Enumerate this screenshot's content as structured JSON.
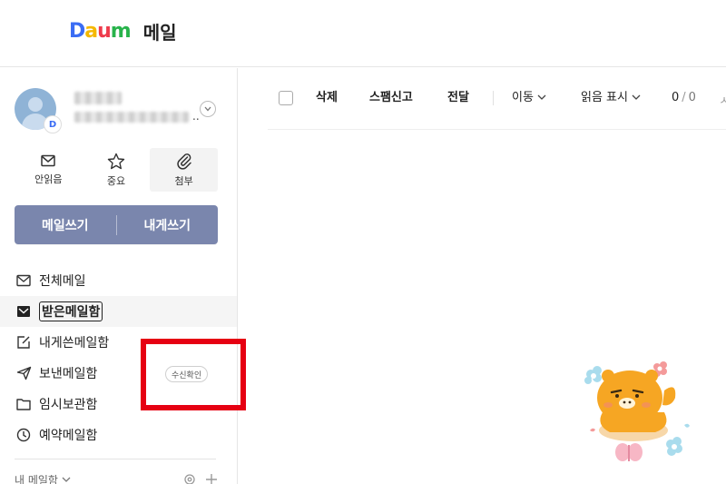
{
  "header": {
    "logo_letters": [
      "D",
      "a",
      "u",
      "m"
    ],
    "service_name": "메일"
  },
  "profile": {
    "badge_letter": "D",
    "email_suffix": ".."
  },
  "quick_actions": [
    {
      "label": "안읽음",
      "icon": "envelope-icon"
    },
    {
      "label": "중요",
      "icon": "star-icon"
    },
    {
      "label": "첨부",
      "icon": "paperclip-icon"
    }
  ],
  "compose": {
    "write_label": "메일쓰기",
    "self_label": "내게쓰기"
  },
  "folders": [
    {
      "label": "전체메일",
      "icon": "all-mail-icon"
    },
    {
      "label": "받은메일함",
      "icon": "inbox-icon",
      "active": true
    },
    {
      "label": "내게쓴메일함",
      "icon": "edit-icon"
    },
    {
      "label": "보낸메일함",
      "icon": "send-icon"
    },
    {
      "label": "임시보관함",
      "icon": "folder-icon"
    },
    {
      "label": "예약메일함",
      "icon": "clock-icon"
    }
  ],
  "sent_badge": "수신확인",
  "my_mailbox": {
    "label": "내 메일함"
  },
  "toolbar": {
    "delete": "삭제",
    "spam": "스팸신고",
    "forward": "전달",
    "move": "이동",
    "mark_read": "읽음 표시",
    "count_current": "0",
    "count_sep": "/",
    "count_total": "0",
    "more": "ㅅ"
  },
  "colors": {
    "compose_bg": "#7a86ad",
    "highlight": "#e60012",
    "character": "#f6a623"
  }
}
